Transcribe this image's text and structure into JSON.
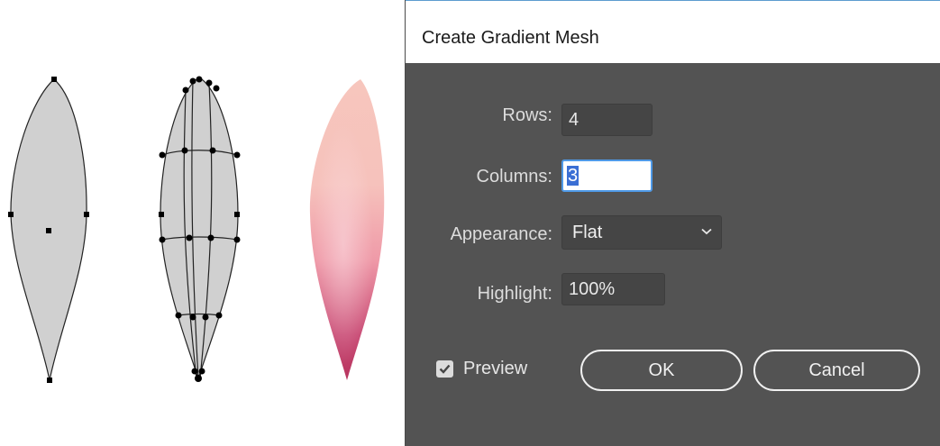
{
  "dialog": {
    "title": "Create Gradient Mesh",
    "rows": {
      "label": "Rows:",
      "value": "4"
    },
    "columns": {
      "label": "Columns:",
      "value": "3"
    },
    "appearance": {
      "label": "Appearance:",
      "value": "Flat",
      "icon": "chevron-down-icon"
    },
    "highlight": {
      "label": "Highlight:",
      "value": "100%"
    },
    "preview": {
      "label": "Preview",
      "checked": true,
      "icon": "checkmark-icon"
    },
    "ok_label": "OK",
    "cancel_label": "Cancel"
  },
  "colors": {
    "dialog_bg": "#535353",
    "field_bg": "#454545",
    "focus_border": "#4f9ae8",
    "selection": "#3b6fd4",
    "shape_fill": "#d0d0d0",
    "petal_top": "#f7c6bd",
    "petal_mid": "#ef9aa8",
    "petal_bottom": "#c23e6a"
  }
}
